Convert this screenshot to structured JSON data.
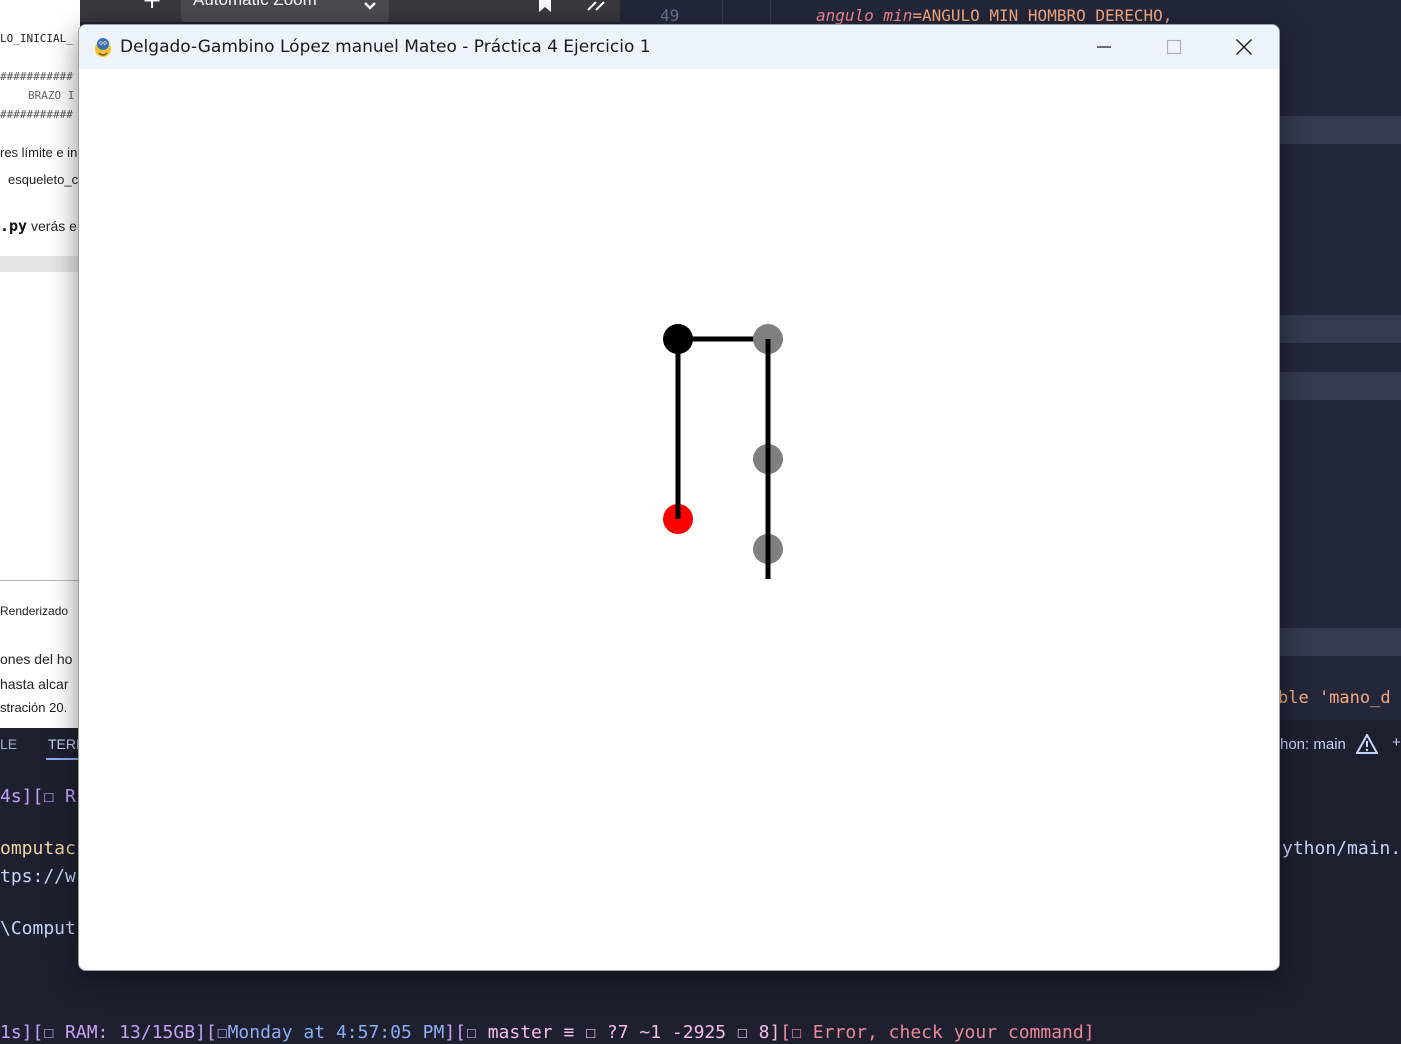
{
  "window": {
    "title": "Delgado-Gambino López manuel Mateo - Práctica 4 Ejercicio 1",
    "controls": [
      "minimize",
      "maximize",
      "close"
    ],
    "icon": "pygame-snake-icon"
  },
  "pdf_viewer": {
    "zoom_label": "Automatic Zoom",
    "lines": [
      "LO_INICIAL_",
      "###########",
      "BRAZO I",
      "###########",
      "res límite e ini",
      "esqueleto_c",
      ".py",
      "verás e",
      "Renderizado",
      "ones del ho",
      "hasta alcar",
      "stración 20."
    ]
  },
  "editor": {
    "line_number": "49",
    "code_param": "angulo_min",
    "code_value": "=ANGULO_MIN_HOMBRO_DERECHO,",
    "error_fragment": "ble 'mano_d",
    "status_fragment": "hon: main"
  },
  "panel_tabs": [
    "LE",
    "TERI"
  ],
  "terminal": {
    "lines": [
      "4s][☐ R",
      "omputac",
      "tps://w",
      "\\Comput"
    ],
    "path_fragment": "ython/main.p",
    "prompt_time": "1s][☐ RAM: 13/15GB][☐",
    "prompt_day": "Monday at 4:57:05 PM",
    "prompt_git": "][☐ ",
    "prompt_branch": "master ≡ ☐ ?7 ~1 -2925 ☐ 8]",
    "prompt_error": "[☐ Error, check your command]"
  },
  "skeleton": {
    "colors": {
      "active": "#000000",
      "inactive": "#808080",
      "end": "#ff0000",
      "bone": "#000000"
    }
  }
}
